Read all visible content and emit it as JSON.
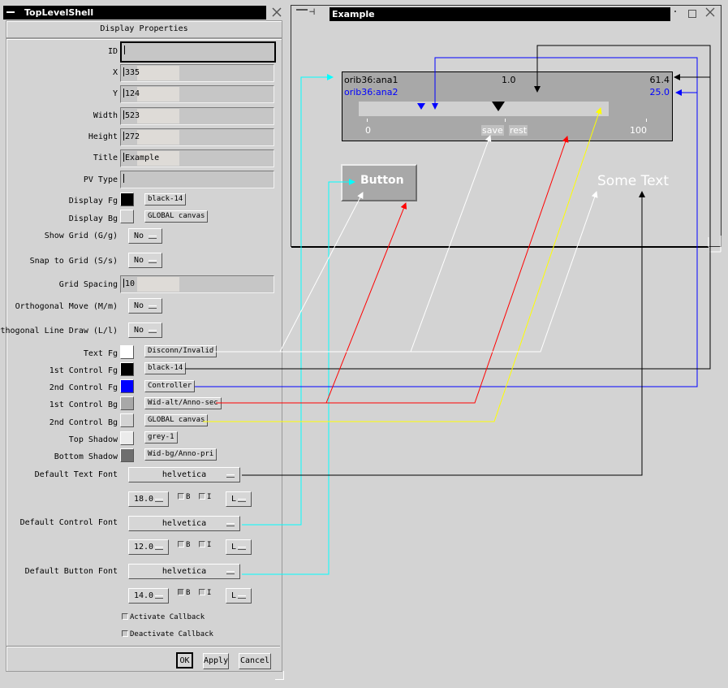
{
  "left_window": {
    "title": "TopLevelShell",
    "heading": "Display Properties",
    "fields": [
      {
        "label": "ID",
        "value": ""
      },
      {
        "label": "X",
        "value": "335"
      },
      {
        "label": "Y",
        "value": "124"
      },
      {
        "label": "Width",
        "value": "523"
      },
      {
        "label": "Height",
        "value": "272"
      },
      {
        "label": "Title",
        "value": "Example"
      },
      {
        "label": "PV Type",
        "value": ""
      }
    ],
    "display_fg": {
      "label": "Display Fg",
      "color": "#000000",
      "button": "black-14"
    },
    "display_bg": {
      "label": "Display Bg",
      "color": "#d3d3d3",
      "button": "GLOBAL canvas"
    },
    "show_grid": {
      "label": "Show Grid (G/g)",
      "value": "No"
    },
    "snap_grid": {
      "label": "Snap to Grid (S/s)",
      "value": "No"
    },
    "grid_spacing": {
      "label": "Grid Spacing",
      "value": "10"
    },
    "ortho_move": {
      "label": "Orthogonal Move (M/m)",
      "value": "No"
    },
    "ortho_line": {
      "label": "Orthogonal Line Draw (L/l)",
      "value": "No"
    },
    "colors": [
      {
        "label": "Text Fg",
        "color": "#ffffff",
        "button": "Disconn/Invalid"
      },
      {
        "label": "1st Control Fg",
        "color": "#000000",
        "button": "black-14"
      },
      {
        "label": "2nd Control Fg",
        "color": "#0000ff",
        "button": "Controller"
      },
      {
        "label": "1st Control Bg",
        "color": "#a8a8a8",
        "button": "Wid-alt/Anno-sec"
      },
      {
        "label": "2nd Control Bg",
        "color": "#d3d3d3",
        "button": "GLOBAL canvas"
      },
      {
        "label": "Top Shadow",
        "color": "#ebebeb",
        "button": "grey-1"
      },
      {
        "label": "Bottom Shadow",
        "color": "#6e6e6e",
        "button": "Wid-bg/Anno-pri"
      }
    ],
    "fonts": [
      {
        "label": "Default Text Font",
        "family": "helvetica"
      },
      {
        "label": "Default Control Font",
        "family": "helvetica",
        "size": "12.0",
        "bold": "B",
        "italic": "I",
        "align": "L"
      },
      {
        "label": "Default Button Font",
        "family": "helvetica",
        "size": "14.0",
        "bold": "B",
        "italic": "I",
        "align": "L"
      }
    ],
    "text_font_row": {
      "size": "18.0",
      "bold": "B",
      "italic": "I",
      "align": "L"
    },
    "callbacks": {
      "activate": "Activate Callback",
      "deactivate": "Deactivate Callback"
    },
    "buttons": {
      "ok": "OK",
      "apply": "Apply",
      "cancel": "Cancel"
    }
  },
  "right_window": {
    "title": "Example",
    "slider": {
      "pv1": "orib36:ana1",
      "pv2": "orib36:ana2",
      "mid_value": "1.0",
      "value1": "61.4",
      "value2": "25.0",
      "min_label": "0",
      "max_label": "100",
      "save": "save",
      "rest": "rest",
      "position_fraction": 0.56,
      "pointer2_fraction": 0.25
    },
    "button_label": "Button",
    "some_text": "Some Text"
  },
  "colors": {
    "cyan": "#00ffff",
    "blue": "#0000ff",
    "red": "#ff0000",
    "yellow": "#ffff00",
    "white": "#ffffff",
    "black": "#000000"
  }
}
